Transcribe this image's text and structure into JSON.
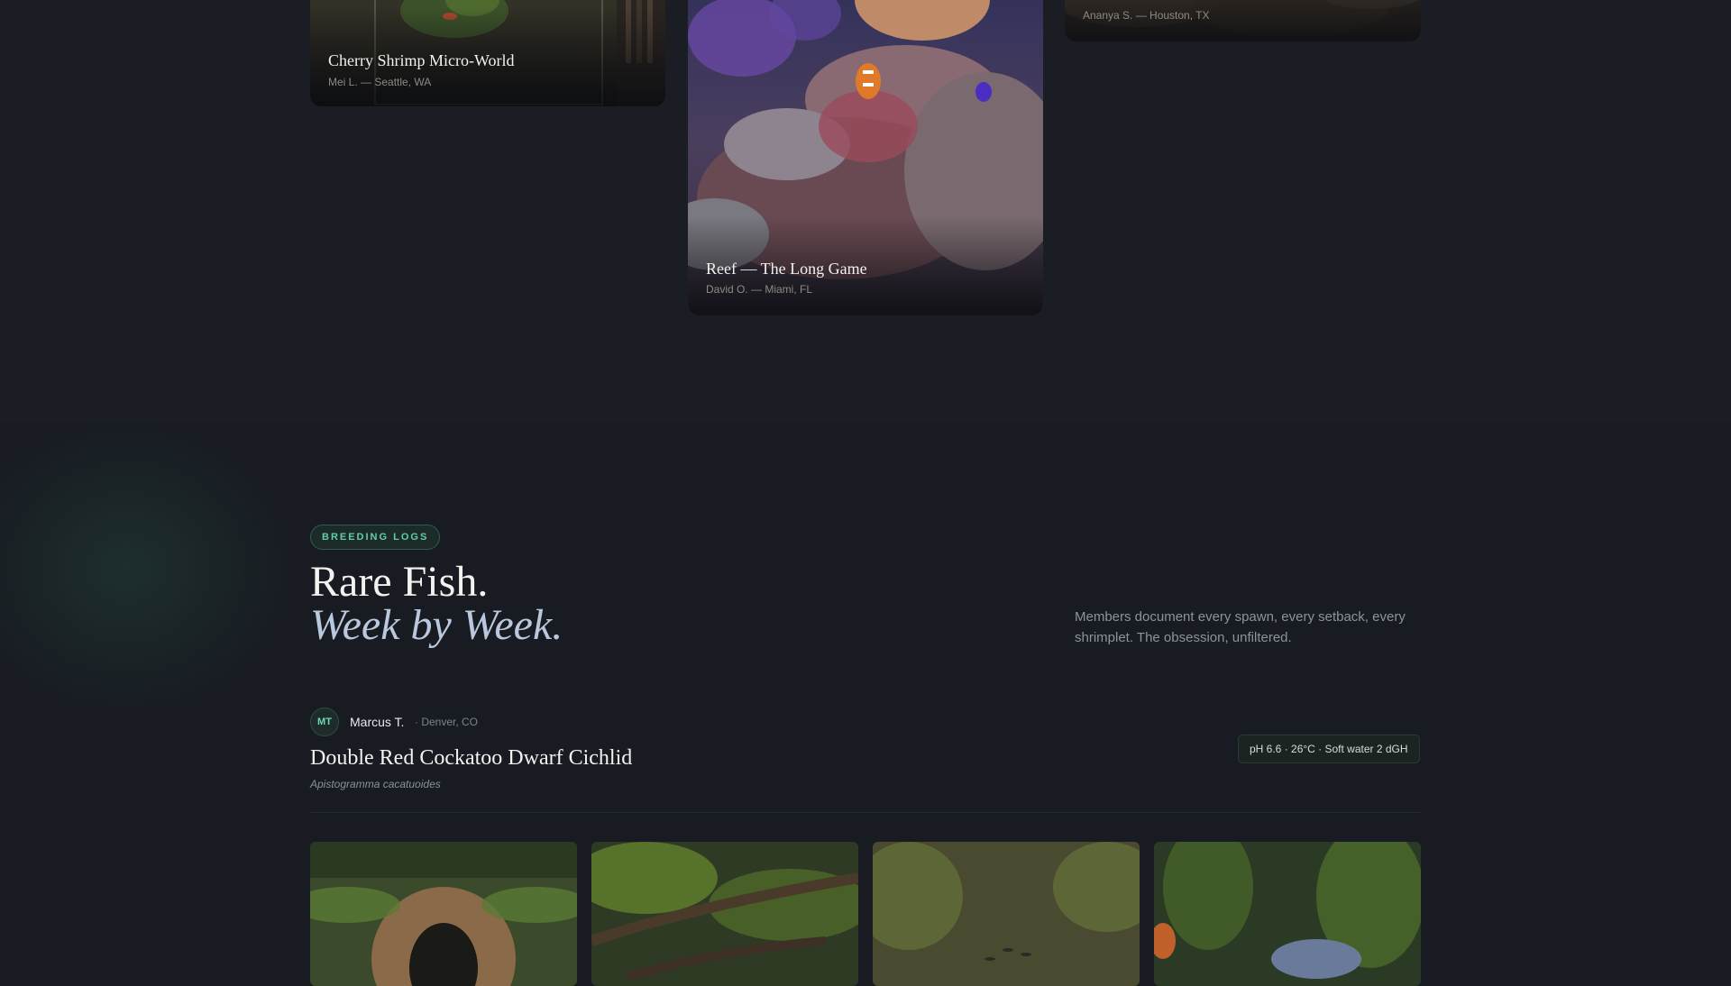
{
  "gallery": {
    "cards": [
      {
        "title": "Cherry Shrimp Micro-World",
        "meta": "Mei L. — Seattle, WA"
      },
      {
        "title": "Reef — The Long Game",
        "meta": "David O. — Miami, FL"
      },
      {
        "title": "",
        "meta": "Ananya S. — Houston, TX"
      }
    ]
  },
  "breeding": {
    "tag": "BREEDING LOGS",
    "headline": "Rare Fish.",
    "headline_italic": "Week by Week.",
    "intro": "Members document every spawn, every setback, every shrimplet. The obsession, unfiltered.",
    "log": {
      "avatar_initials": "MT",
      "author": "Marcus T.",
      "location": "· Denver, CO",
      "title": "Double Red Cockatoo Dwarf Cichlid",
      "species": "Apistogramma cacatuoides",
      "params": "pH 6.6 · 26°C · Soft water 2 dGH"
    }
  },
  "colors": {
    "accent": "#5fcfa8",
    "background": "#181c22",
    "top_background": "#1a1e24"
  }
}
